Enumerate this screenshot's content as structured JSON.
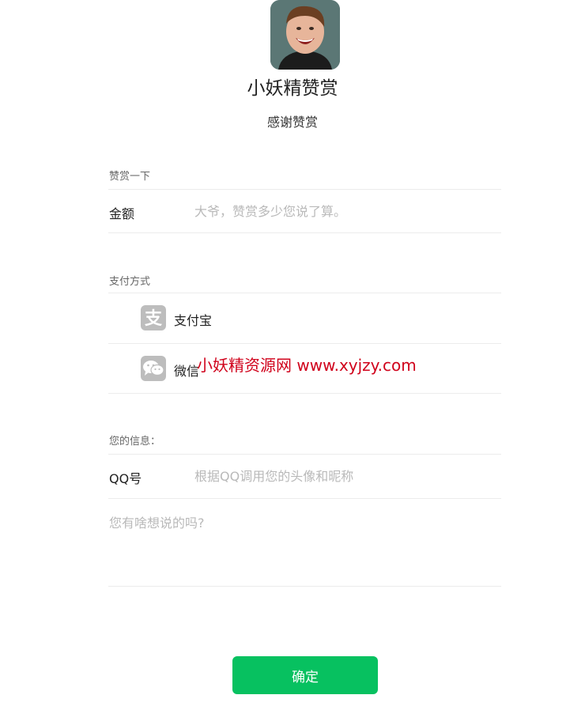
{
  "profile": {
    "name": "小妖精赞赏",
    "subtitle": "感谢赞赏"
  },
  "reward": {
    "section_label": "赞赏一下",
    "amount_label": "金额",
    "amount_placeholder": "大爷，赞赏多少您说了算。"
  },
  "payment": {
    "section_label": "支付方式",
    "methods": [
      {
        "label": "支付宝",
        "icon": "alipay-icon"
      },
      {
        "label": "微信",
        "icon": "wechat-icon"
      }
    ]
  },
  "info": {
    "section_label": "您的信息：",
    "qq_label": "QQ号",
    "qq_placeholder": "根据QQ调用您的头像和昵称",
    "message_placeholder": "您有啥想说的吗?"
  },
  "actions": {
    "confirm_label": "确定"
  },
  "watermark": "小妖精资源网 www.xyjzy.com",
  "colors": {
    "accent": "#07c160",
    "watermark": "#d0021b",
    "icon_gray": "#bdbdbd"
  }
}
